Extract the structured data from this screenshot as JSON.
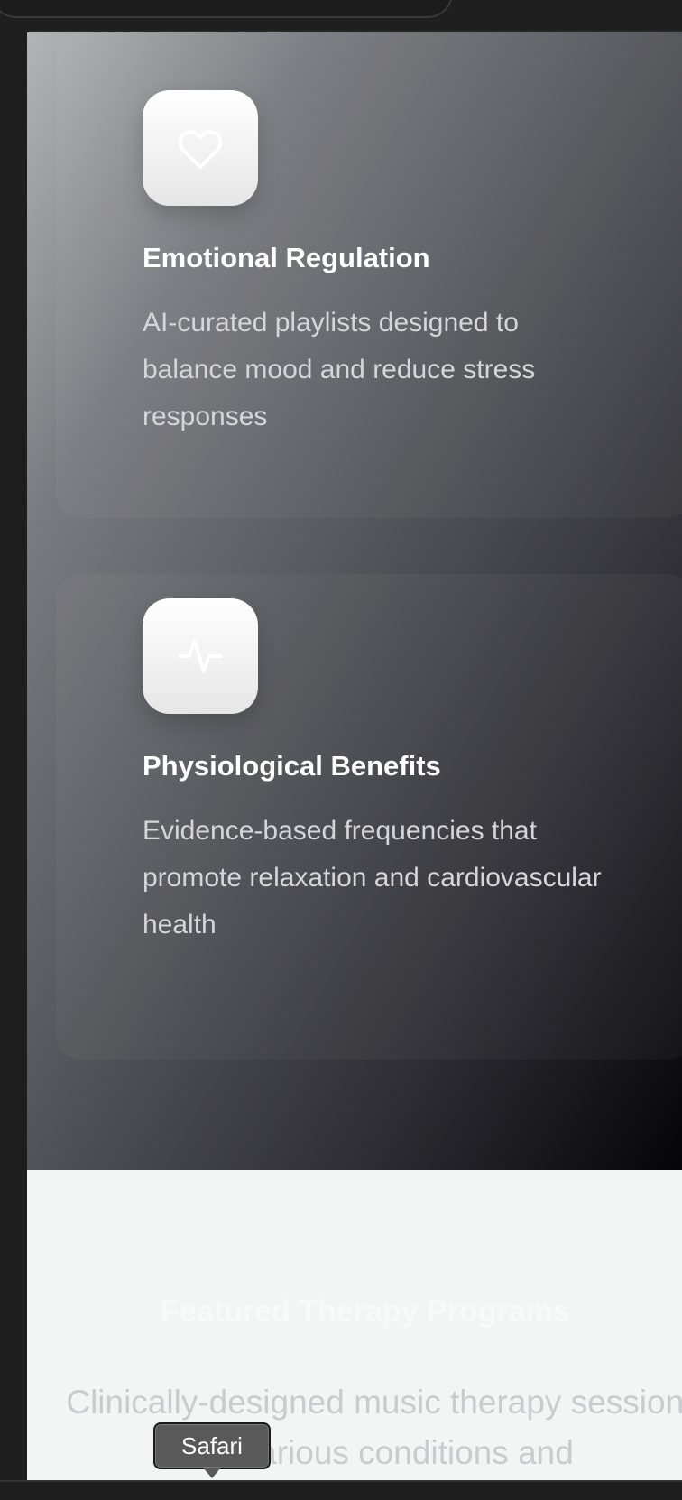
{
  "features": [
    {
      "icon": "heart-icon",
      "title": "Emotional Regulation",
      "description": "AI-curated playlists designed to balance mood and reduce stress responses"
    },
    {
      "icon": "pulse-icon",
      "title": "Physiological Benefits",
      "description": "Evidence-based frequencies that promote relaxation and cardiovascular health"
    }
  ],
  "programs": {
    "title": "Featured Therapy Programs",
    "subtitle": "Clinically-designed music therapy sessions for various conditions and"
  },
  "tooltip": {
    "label": "Safari"
  },
  "colors": {
    "card_icon_bg": "#ffffff",
    "programs_bg": "#f3f5f4",
    "tooltip_bg": "#595959"
  }
}
